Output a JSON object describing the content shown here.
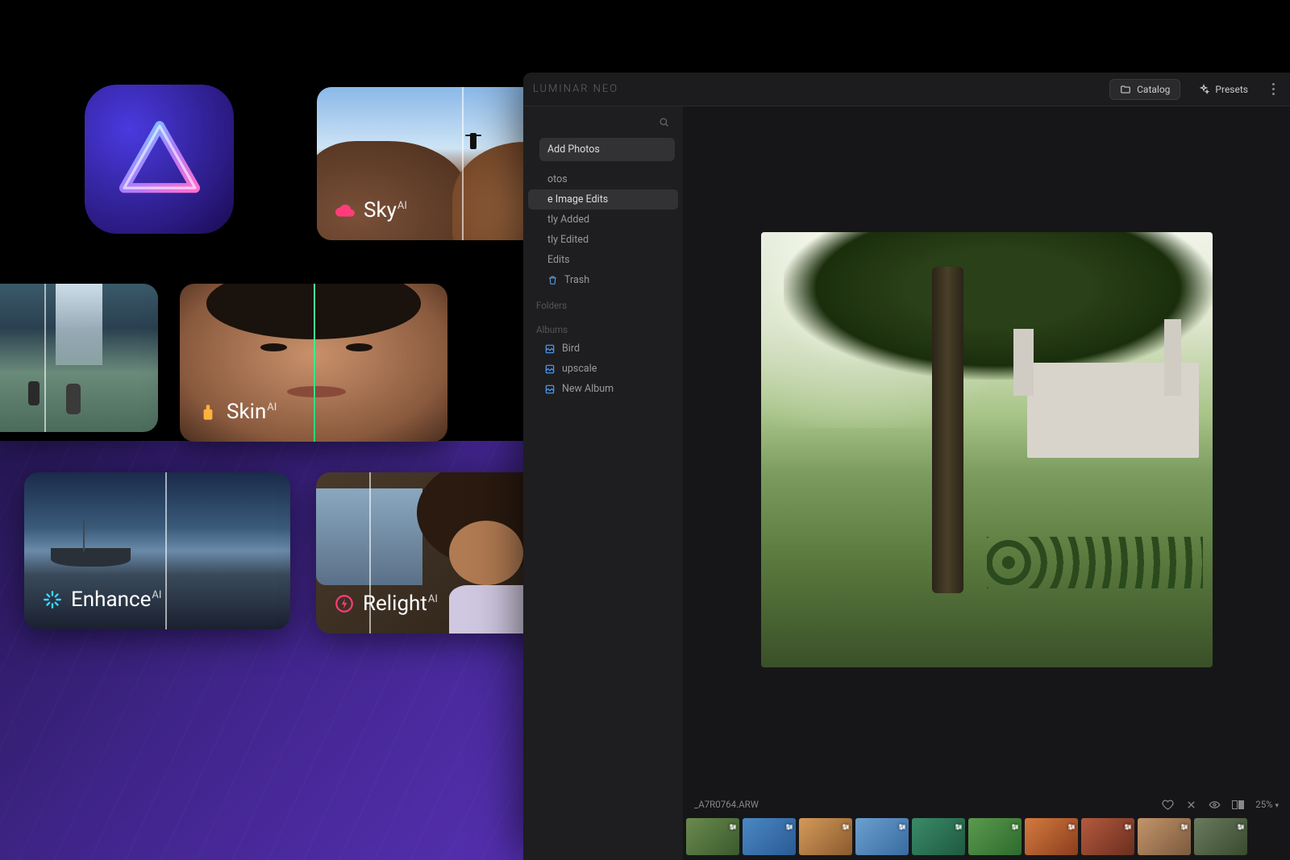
{
  "features": {
    "sky": {
      "label": "Sky",
      "superscript": "AI",
      "icon_color": "#ff3d7a"
    },
    "skin": {
      "label": "Skin",
      "superscript": "AI",
      "icon_color": "#ffb13d"
    },
    "enhance": {
      "label": "Enhance",
      "superscript": "AI",
      "icon_color": "#3dd6ff"
    },
    "relight": {
      "label": "Relight",
      "superscript": "AI",
      "icon_color": "#ff3d7a"
    }
  },
  "app": {
    "brand": "LUMINAR NEO",
    "header": {
      "catalog": "Catalog",
      "presets": "Presets"
    },
    "sidebar": {
      "add_photos": "Add Photos",
      "items": [
        {
          "label": "otos"
        },
        {
          "label": "e Image Edits",
          "selected": true
        },
        {
          "label": "tly Added"
        },
        {
          "label": "tly Edited"
        },
        {
          "label": "Edits"
        },
        {
          "label": "Trash",
          "icon": "trash"
        }
      ],
      "folders_header": "Folders",
      "albums_header": "Albums",
      "albums": [
        {
          "label": "Bird"
        },
        {
          "label": "upscale"
        },
        {
          "label": "New Album"
        }
      ]
    },
    "viewer": {
      "filename": "_A7R0764.ARW",
      "zoom": "25%",
      "thumbs": [
        {
          "color1": "#6a8a4e",
          "color2": "#3a5a2e"
        },
        {
          "color1": "#4a88c4",
          "color2": "#2a5a94"
        },
        {
          "color1": "#d49a5a",
          "color2": "#8a5a2e"
        },
        {
          "color1": "#6aa0d0",
          "color2": "#3a6aa0"
        },
        {
          "color1": "#3a8a6a",
          "color2": "#1e5a3e"
        },
        {
          "color1": "#5a9a4e",
          "color2": "#2e6a2e"
        },
        {
          "color1": "#d47a3e",
          "color2": "#8a3e1e"
        },
        {
          "color1": "#b45a3e",
          "color2": "#6a2e1e"
        },
        {
          "color1": "#c4946a",
          "color2": "#7a5a3e"
        },
        {
          "color1": "#6a7a5e",
          "color2": "#3a4a2e"
        }
      ]
    }
  }
}
